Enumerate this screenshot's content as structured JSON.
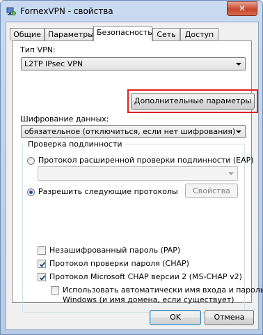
{
  "window": {
    "title": "FornexVPN - свойства",
    "close_glyph": "✕"
  },
  "tabs": [
    {
      "label": "Общие"
    },
    {
      "label": "Параметры"
    },
    {
      "label": "Безопасность",
      "active": true
    },
    {
      "label": "Сеть"
    },
    {
      "label": "Доступ"
    }
  ],
  "security": {
    "vpn_type_label": "Тип VPN:",
    "vpn_type_value": "L2TP IPsec VPN",
    "advanced_button": "Дополнительные параметры",
    "encryption_label": "Шифрование данных:",
    "encryption_value": "обязательное (отключиться, если нет шифрования)",
    "auth_group_title": "Проверка подлинности",
    "eap_radio_label": "Протокол расширенной проверки подлинности (EAP)",
    "eap_combo_value": "",
    "allow_radio_label": "Разрешить следующие протоколы",
    "properties_button": "Свойства",
    "protocols": [
      {
        "label": "Незашифрованный пароль (PAP)",
        "checked": false
      },
      {
        "label": "Протокол проверки пароля (CHAP)",
        "checked": true
      },
      {
        "label": "Протокол Microsoft CHAP версии 2 (MS-CHAP v2)",
        "checked": true
      }
    ],
    "auto_logon_line1": "Использовать автоматически имя входа и пароль",
    "auto_logon_line2": "Windows (и имя домена, если существует)",
    "auto_logon_checked": false
  },
  "footer": {
    "ok_button": "OK",
    "cancel_button": "Отмена"
  },
  "colors": {
    "highlight": "#e02020",
    "title_bar": "#c9daf0",
    "close": "#c7452c"
  }
}
